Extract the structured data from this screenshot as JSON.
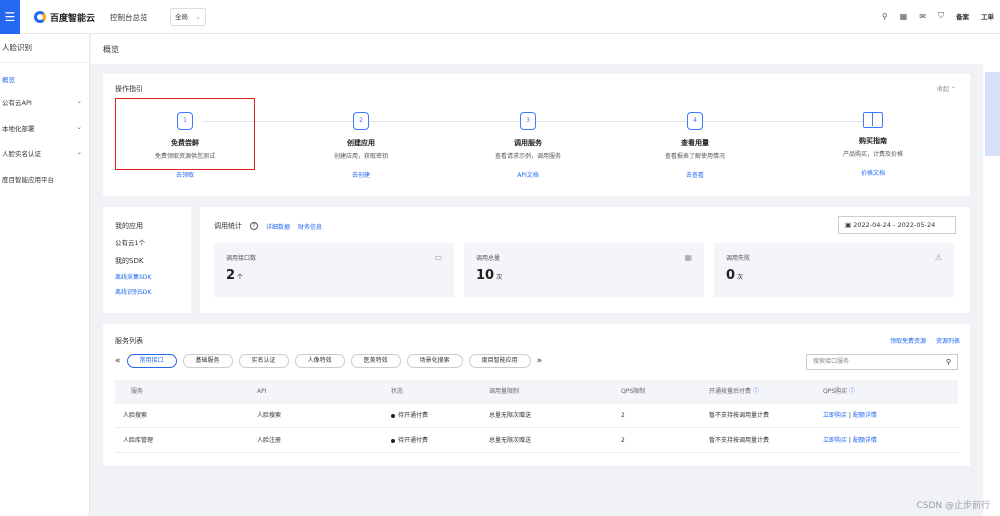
{
  "topbar": {
    "brand": "百度智能云",
    "console": "控制台总览",
    "region": "全局",
    "right_items": [
      "备案",
      "工单"
    ]
  },
  "sidebar": {
    "title": "人脸识别",
    "items": [
      {
        "label": "概览",
        "active": true
      },
      {
        "label": "公有云API",
        "has_chevron": true
      },
      {
        "label": "本地化部署",
        "has_chevron": true
      },
      {
        "label": "人脸实名认证",
        "has_chevron": true
      },
      {
        "label": "度目智能应用平台"
      }
    ]
  },
  "page": {
    "title": "概览"
  },
  "guide": {
    "title": "操作指引",
    "collapse": "收起",
    "steps": [
      {
        "num": "1",
        "name": "免费尝鲜",
        "desc": "免费领取资源供您测试",
        "link": "去领取"
      },
      {
        "num": "2",
        "name": "创建应用",
        "desc": "创建应用，获取密钥",
        "link": "去创建"
      },
      {
        "num": "3",
        "name": "调用服务",
        "desc": "查看请求示例，调用服务",
        "link": "API文档"
      },
      {
        "num": "4",
        "name": "查看用量",
        "desc": "查看报表了解使用情况",
        "link": "去查看"
      },
      {
        "name": "购买指南",
        "desc": "产品购买，计费及价格",
        "link": "价格文档"
      }
    ]
  },
  "apps": {
    "my_apps": "我的应用",
    "count": "公有云1个",
    "sdk": "我的SDK",
    "sdk_links": [
      "离线采集SDK",
      "离线识别SDK"
    ]
  },
  "stats": {
    "title": "调用统计",
    "links": [
      "详细数据",
      "财务信息"
    ],
    "date_range": "2022-04-24 - 2022-05-24",
    "cards": [
      {
        "label": "调用接口数",
        "value": "2",
        "unit": "个"
      },
      {
        "label": "调用总量",
        "value": "10",
        "unit": "次"
      },
      {
        "label": "调用失败",
        "value": "0",
        "unit": "次"
      }
    ]
  },
  "services": {
    "title": "服务列表",
    "links": [
      "领取免费资源",
      "资源列表"
    ],
    "tabs": [
      "常用接口",
      "基础服务",
      "实名认证",
      "人像特效",
      "医美特效",
      "场景化搜索",
      "度目智能应用"
    ],
    "search_placeholder": "搜索接口服务",
    "columns": [
      "服务",
      "API",
      "状态",
      "调用量限制",
      "QPS限制",
      "开通按量后付费",
      "QPS购买"
    ],
    "rows": [
      {
        "service": "人脸搜索",
        "api": "人脸搜索",
        "status": "待开通付费",
        "limit": "总量无限次赠送",
        "qps": "2",
        "postpay": "暂不支持按调用量计费",
        "buy": "立即购买",
        "detail": "配额详情"
      },
      {
        "service": "人脸库管理",
        "api": "人脸注册",
        "status": "待开通付费",
        "limit": "总量无限次赠送",
        "qps": "2",
        "postpay": "暂不支持按调用量计费",
        "buy": "立即购买",
        "detail": "配额详情"
      }
    ]
  },
  "watermark": "CSDN @止步前行"
}
